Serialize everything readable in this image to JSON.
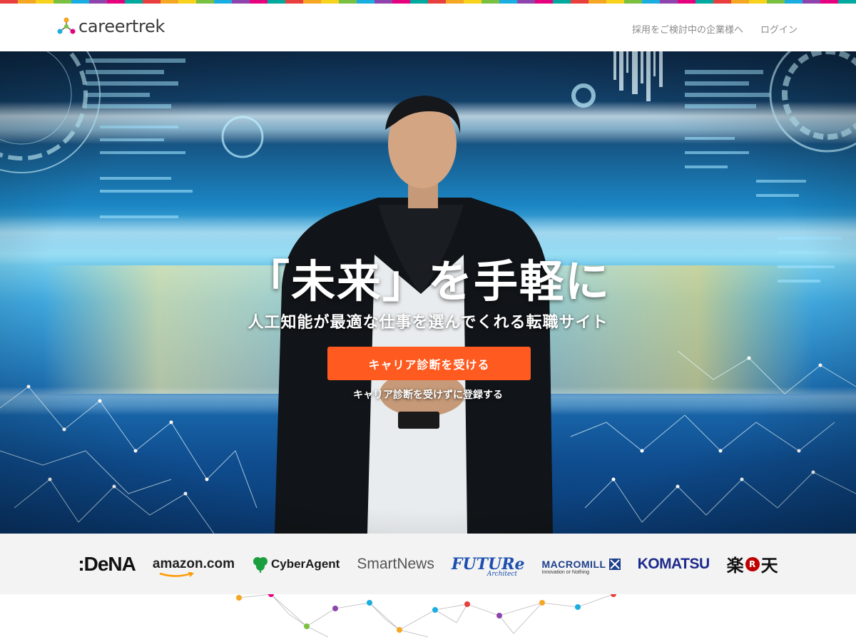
{
  "brand": {
    "name": "careertrek",
    "stripe_colors": [
      "#e83e3e",
      "#f5a623",
      "#f8d21c",
      "#7ac142",
      "#1aaee0",
      "#8e44ad",
      "#e6007e",
      "#00a99d"
    ]
  },
  "header": {
    "nav": [
      {
        "label": "採用をご検討中の企業様へ"
      },
      {
        "label": "ログイン"
      }
    ]
  },
  "hero": {
    "headline": "「未来」を手軽に",
    "subline": "人工知能が最適な仕事を選んでくれる転職サイト",
    "cta_label": "キャリア診断を受ける",
    "cta_secondary": "キャリア診断を受けずに登録する",
    "accent": "#ff5a1f"
  },
  "company_logos": [
    {
      "name": "DeNA",
      "text": ":DeNA"
    },
    {
      "name": "amazon",
      "text": "amazon.com"
    },
    {
      "name": "cyberagent",
      "text": "CyberAgent"
    },
    {
      "name": "smartnews",
      "text": "SmartNews"
    },
    {
      "name": "future",
      "text": "FUTURe",
      "sub": "Architect"
    },
    {
      "name": "macromill",
      "text": "MACROMILL",
      "sub": "Innovation or Nothing"
    },
    {
      "name": "komatsu",
      "text": "KOMATSU"
    },
    {
      "name": "rakuten",
      "left": "楽",
      "mark": "R",
      "right": "天"
    }
  ]
}
